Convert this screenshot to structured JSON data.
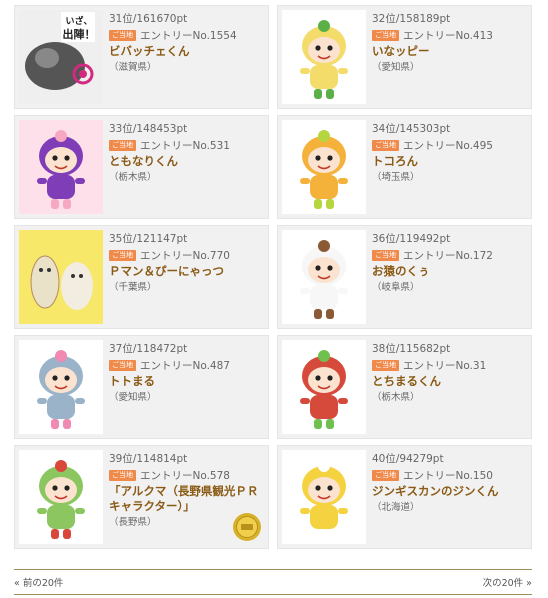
{
  "entries": [
    {
      "rank": "31位/161670pt",
      "badge": "ご当地",
      "entry": "エントリーNo.1554",
      "name": "ビバッチェくん",
      "pref": "（滋賀県）",
      "thumb_bg": "#f2f2f2",
      "body": "#6a6a6a",
      "accent": "#d12a80",
      "icon": "boar-mascot-icon",
      "text_overlay": "いざ、出陣！"
    },
    {
      "rank": "32位/158189pt",
      "badge": "ご当地",
      "entry": "エントリーNo.413",
      "name": "いなッピー",
      "pref": "（愛知県）",
      "thumb_bg": "#ffffff",
      "body": "#f3dc6a",
      "accent": "#5ab046",
      "icon": "rice-mascot-icon"
    },
    {
      "rank": "33位/148453pt",
      "badge": "ご当地",
      "entry": "エントリーNo.531",
      "name": "ともなりくん",
      "pref": "（栃木県）",
      "thumb_bg": "#fde0ea",
      "body": "#7f3db8",
      "accent": "#f6a7c1",
      "icon": "purple-mascot-icon"
    },
    {
      "rank": "34位/145303pt",
      "badge": "ご当地",
      "entry": "エントリーNo.495",
      "name": "トコろん",
      "pref": "（埼玉県）",
      "thumb_bg": "#ffffff",
      "body": "#f4b23a",
      "accent": "#b6d63f",
      "icon": "orange-mascot-icon"
    },
    {
      "rank": "35位/121147pt",
      "badge": "ご当地",
      "entry": "エントリーNo.770",
      "name": "Ｐマン＆ぴーにゃっつ",
      "pref": "（千葉県）",
      "thumb_bg": "#f7e86a",
      "body": "#e9e1c8",
      "accent": "#b38b5e",
      "icon": "peanut-mascot-icon"
    },
    {
      "rank": "36位/119492pt",
      "badge": "ご当地",
      "entry": "エントリーNo.172",
      "name": "お猿のくぅ",
      "pref": "（岐阜県）",
      "thumb_bg": "#ffffff",
      "body": "#f7f7f7",
      "accent": "#8b5a35",
      "icon": "monkey-mascot-icon"
    },
    {
      "rank": "37位/118472pt",
      "badge": "ご当地",
      "entry": "エントリーNo.487",
      "name": "トトまる",
      "pref": "（愛知県）",
      "thumb_bg": "#ffffff",
      "body": "#9ab3c9",
      "accent": "#f08ab3",
      "icon": "robot-mascot-icon"
    },
    {
      "rank": "38位/115682pt",
      "badge": "ご当地",
      "entry": "エントリーNo.31",
      "name": "とちまるくん",
      "pref": "（栃木県）",
      "thumb_bg": "#ffffff",
      "body": "#d64a3b",
      "accent": "#6fc04f",
      "icon": "tochimaru-mascot-icon"
    },
    {
      "rank": "39位/114814pt",
      "badge": "ご当地",
      "entry": "エントリーNo.578",
      "name": "「アルクマ（長野県観光ＰＲキャラクター）」",
      "pref": "（長野県）",
      "thumb_bg": "#ffffff",
      "body": "#8cc660",
      "accent": "#d9473b",
      "icon": "bear-mascot-icon",
      "medal": "medal-icon"
    },
    {
      "rank": "40位/94279pt",
      "badge": "ご当地",
      "entry": "エントリーNo.150",
      "name": "ジンギスカンのジンくん",
      "pref": "（北海道）",
      "thumb_bg": "#ffffff",
      "body": "#f5d23f",
      "accent": "#ffffff",
      "icon": "sheep-mascot-icon"
    }
  ],
  "pager": {
    "prev": "« 前の20件",
    "next": "次の20件 »"
  },
  "colors": {
    "badge": "#f08a4b",
    "name": "#8a5a14",
    "card_bg": "#f1f1f1",
    "rule": "#9c8d5b"
  }
}
